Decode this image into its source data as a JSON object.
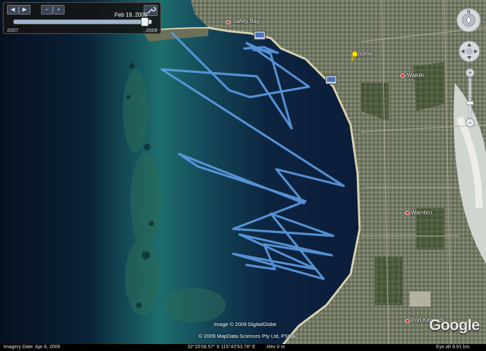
{
  "time_slider": {
    "current_date": "Feb 19, 2009",
    "start_year": "2007",
    "end_year": "2009",
    "position": 0.95
  },
  "places": {
    "safety_bay": "Safety Bay",
    "home": "home",
    "waikiki": "Waikiki",
    "warnbro": "Warnbro",
    "port_kennedy": "Port Kennedy"
  },
  "copyright": {
    "line1": "Image © 2009 DigitalGlobe",
    "line2": "© 2009 MapData Sciences Pty Ltd, PSMA"
  },
  "logo": "Google",
  "status": {
    "imagery_date": "Imagery Date: Apr 8, 2006",
    "coordinates": "32°20'08.57\" S    115°42'53.78\" E",
    "elev": "elev   0 m",
    "eye_alt": "Eye alt    9.91 km"
  },
  "colors": {
    "track": "#5b9be0",
    "placemark": "#ffe100",
    "place_dot": "#d8262d"
  },
  "icons": [
    "rewind-icon",
    "play-icon",
    "zoom-out-icon",
    "zoom-in-icon",
    "wrench-icon",
    "compass-icon",
    "pan-icon",
    "zoom-slider",
    "pushpin-icon",
    "photo-icon"
  ]
}
